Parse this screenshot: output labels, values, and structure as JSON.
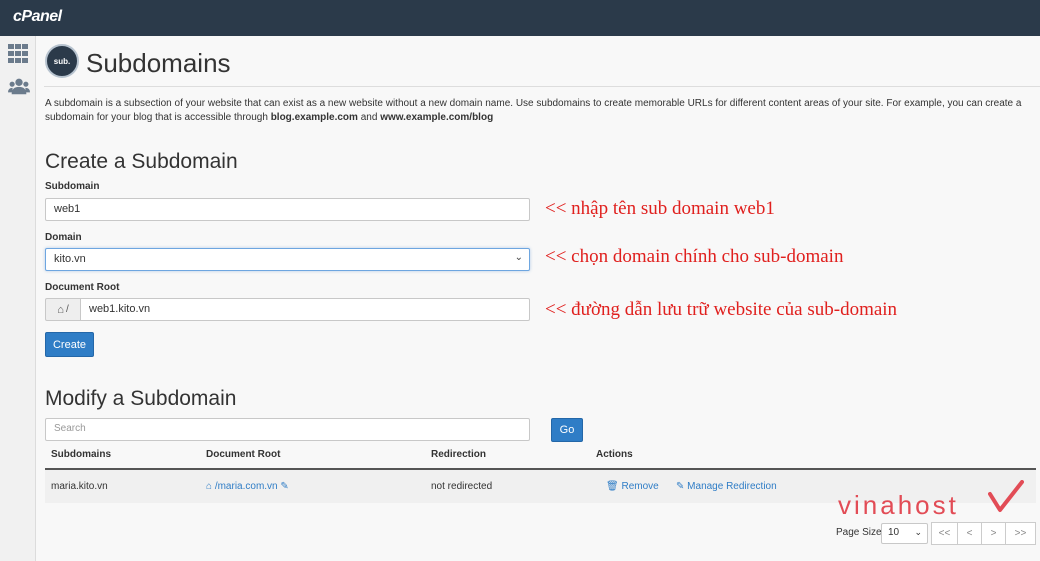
{
  "header": {
    "logo": "cPanel"
  },
  "sidebar": {
    "icons": [
      "apps-grid-icon",
      "users-icon"
    ]
  },
  "page": {
    "icon_text": "sub.",
    "title": "Subdomains",
    "description_part1": "A subdomain is a subsection of your website that can exist as a new website without a new domain name. Use subdomains to create memorable URLs for different content areas of your site. For example, you can create a subdomain for your blog that is accessible through ",
    "description_bold1": "blog.example.com",
    "description_mid": " and ",
    "description_bold2": "www.example.com/blog"
  },
  "create": {
    "heading": "Create a Subdomain",
    "subdomain_label": "Subdomain",
    "subdomain_value": "web1",
    "domain_label": "Domain",
    "domain_value": "kito.vn",
    "docroot_label": "Document Root",
    "docroot_prefix": "/",
    "docroot_value": "web1.kito.vn",
    "button": "Create"
  },
  "annotations": {
    "subdomain_note": "<< nhập tên sub domain web1",
    "domain_note": "<< chọn domain chính cho sub-domain",
    "docroot_note": "<< đường dẫn lưu trữ website của sub-domain"
  },
  "modify": {
    "heading": "Modify a Subdomain",
    "search_placeholder": "Search",
    "go_button": "Go",
    "columns": [
      "Subdomains",
      "Document Root",
      "Redirection",
      "Actions"
    ],
    "rows": [
      {
        "subdomain": "maria.kito.vn",
        "docroot": "/maria.com.vn",
        "redirection": "not redirected",
        "action_remove": "Remove",
        "action_manage": "Manage Redirection"
      }
    ]
  },
  "pagination": {
    "page_size_label": "Page Size",
    "page_size": "10",
    "first": "<<",
    "prev": "<",
    "next": ">",
    "last": ">>"
  },
  "watermark": {
    "brand": "vinahost"
  },
  "colors": {
    "topbar": "#2b3a4a",
    "primary": "#2f7dc6",
    "note": "#e0201e",
    "brand": "#e24c56"
  }
}
